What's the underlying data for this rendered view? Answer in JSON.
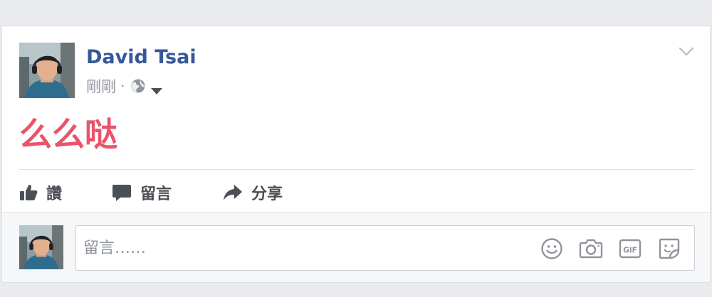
{
  "post": {
    "author": "David Tsai",
    "timestamp": "剛剛",
    "separator": "·",
    "privacy_icon": "globe-icon",
    "privacy_dropdown_icon": "caret-down-icon",
    "options_icon": "chevron-down-icon",
    "text": "么么哒",
    "text_color": "#e9546b"
  },
  "actions": {
    "like_label": "讚",
    "comment_label": "留言",
    "share_label": "分享"
  },
  "comment": {
    "placeholder": "留言……",
    "tools": [
      "emoji-icon",
      "camera-icon",
      "gif-icon",
      "sticker-icon"
    ]
  },
  "colors": {
    "link": "#365899",
    "muted": "#90949c",
    "action": "#4b4f56",
    "background": "#e9ebee"
  }
}
